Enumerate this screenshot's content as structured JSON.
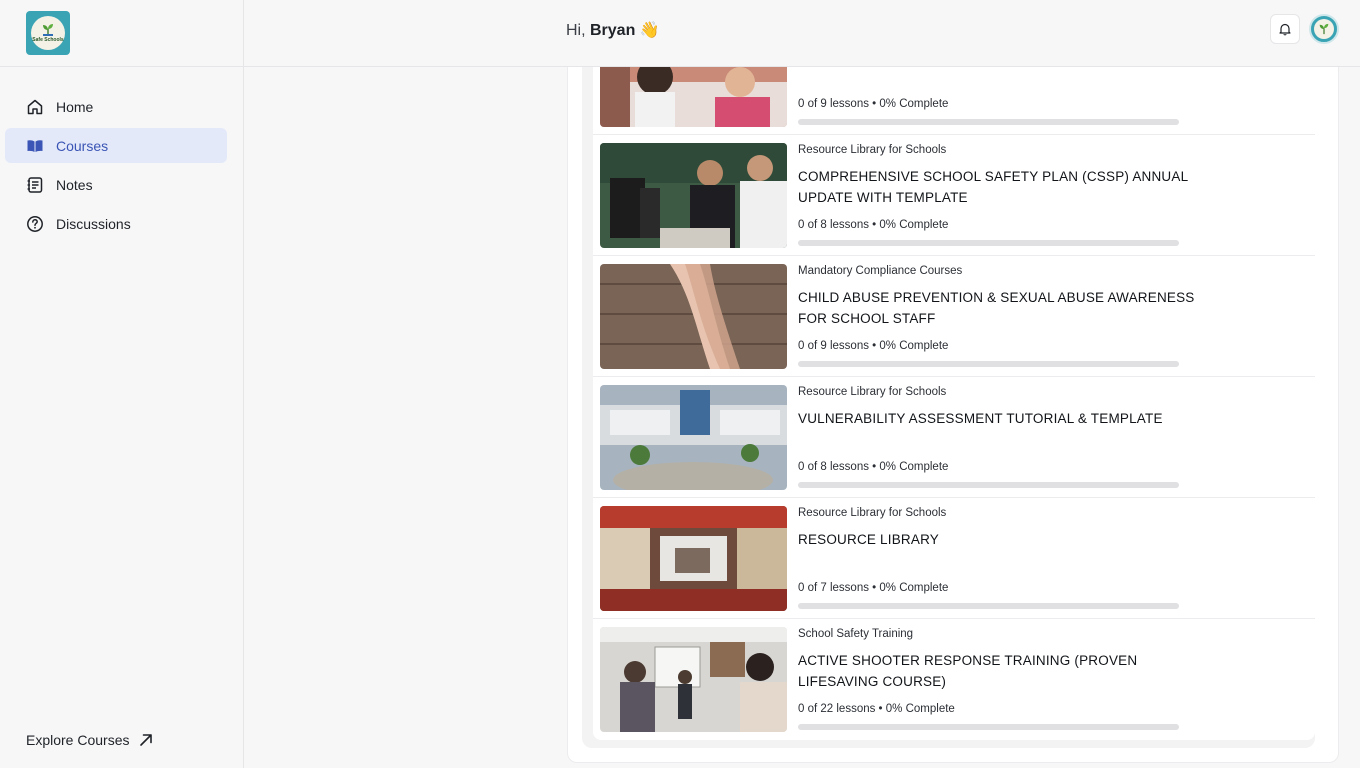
{
  "sidebar": {
    "logo_text": "Safe Schools",
    "items": [
      {
        "label": "Home",
        "icon": "home-icon"
      },
      {
        "label": "Courses",
        "icon": "book-icon",
        "active": true
      },
      {
        "label": "Notes",
        "icon": "notes-icon"
      },
      {
        "label": "Discussions",
        "icon": "question-icon"
      }
    ],
    "explore_label": "Explore Courses"
  },
  "header": {
    "greeting_prefix": "Hi, ",
    "user_name": "Bryan",
    "wave": "👋"
  },
  "courses": [
    {
      "category": "",
      "title": "",
      "meta": "0 of 9 lessons • 0% Complete",
      "progress": 0
    },
    {
      "category": "Resource Library for Schools",
      "title": "COMPREHENSIVE SCHOOL SAFETY PLAN (CSSP) ANNUAL UPDATE WITH TEMPLATE",
      "meta": "0 of 8 lessons • 0% Complete",
      "progress": 0
    },
    {
      "category": "Mandatory Compliance Courses",
      "title": "CHILD ABUSE PREVENTION & SEXUAL ABUSE AWARENESS FOR SCHOOL STAFF",
      "meta": "0 of 9 lessons • 0% Complete",
      "progress": 0
    },
    {
      "category": "Resource Library for Schools",
      "title": "VULNERABILITY ASSESSMENT TUTORIAL & TEMPLATE",
      "meta": "0 of 8 lessons • 0% Complete",
      "progress": 0
    },
    {
      "category": "Resource Library for Schools",
      "title": "RESOURCE LIBRARY",
      "meta": "0 of 7 lessons • 0% Complete",
      "progress": 0
    },
    {
      "category": "School Safety Training",
      "title": "ACTIVE SHOOTER RESPONSE TRAINING (PROVEN LIFESAVING COURSE)",
      "meta": "0 of 22 lessons • 0% Complete",
      "progress": 0
    }
  ],
  "colors": {
    "accent": "#3a55b5",
    "active_bg": "#e4e9f9",
    "logo_bg": "#3aa4b4"
  }
}
